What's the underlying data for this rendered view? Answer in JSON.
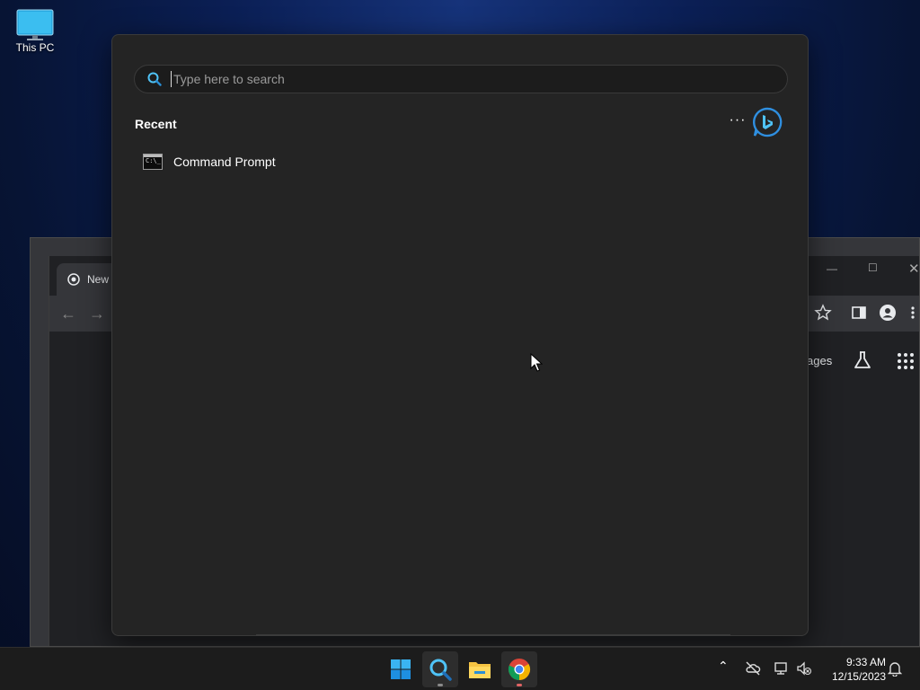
{
  "desktop": {
    "icons": [
      {
        "label": "This PC"
      }
    ]
  },
  "background_window": {
    "tab_title": "New",
    "images_link": "ages"
  },
  "search": {
    "placeholder": "Type here to search",
    "value": "",
    "recent_title": "Recent",
    "more_label": "···",
    "recent_items": [
      {
        "label": "Command Prompt"
      }
    ]
  },
  "taskbar": {
    "apps": [
      "start-icon",
      "search-icon",
      "file-explorer-icon",
      "chrome-icon"
    ],
    "clock": {
      "time": "9:33 AM",
      "date": "12/15/2023"
    }
  },
  "colors": {
    "panel_bg": "#242424",
    "taskbar_bg": "#1c1c1c",
    "accent_blue": "#0078d4",
    "desktop_bg": "#0b1f55"
  }
}
